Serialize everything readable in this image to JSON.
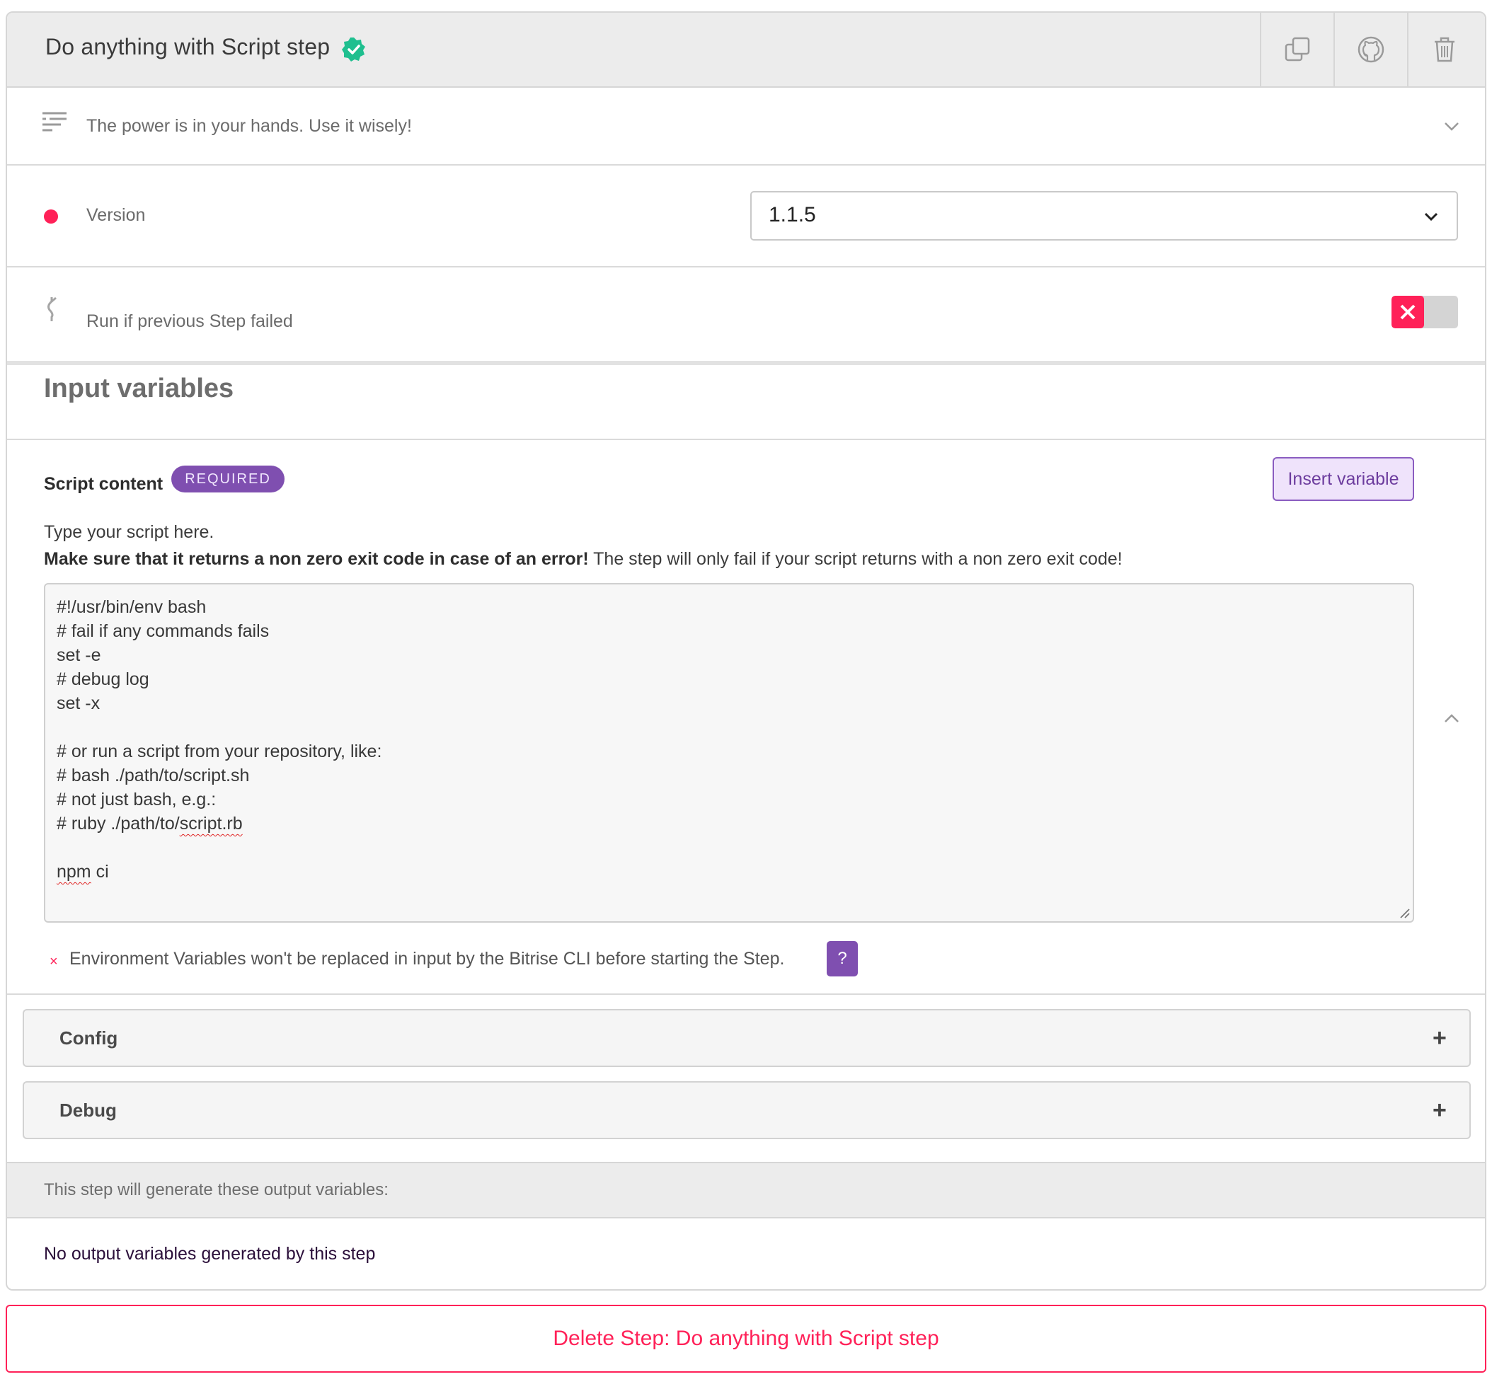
{
  "header": {
    "title": "Do anything with Script step",
    "actions": {
      "duplicate_icon": "duplicate-icon",
      "github_icon": "github-icon",
      "trash_icon": "trash-icon"
    }
  },
  "summary": {
    "text": "The power is in your hands. Use it wisely!"
  },
  "version": {
    "label": "Version",
    "selected": "1.1.5",
    "status_color": "#ff2158"
  },
  "run_if_failed": {
    "label": "Run if previous Step failed",
    "enabled": false
  },
  "inputs": {
    "section_title": "Input variables",
    "script": {
      "label": "Script content",
      "badge": "REQUIRED",
      "insert_button": "Insert variable",
      "description_line1": "Type your script here.",
      "description_bold": "Make sure that it returns a non zero exit code in case of an error!",
      "description_rest": " The step will only fail if your script returns with a non zero exit code!",
      "lines": [
        "#!/usr/bin/env bash",
        "# fail if any commands fails",
        "set -e",
        "# debug log",
        "set -x",
        "",
        "# or run a script from your repository, like:",
        "# bash ./path/to/script.sh",
        "# not just bash, e.g.:",
        "# ruby ./path/to/",
        "",
        "ci"
      ],
      "line10_spell": "script.rb",
      "line12_spell": "npm"
    },
    "env_note": "Environment Variables won't be replaced in input by the Bitrise CLI before starting the Step.",
    "env_mark": "×",
    "help": "?"
  },
  "accordions": {
    "config": "Config",
    "debug": "Debug",
    "expand_symbol": "+"
  },
  "outputs": {
    "header": "This step will generate these output variables:",
    "empty": "No output variables generated by this step"
  },
  "delete_button": "Delete Step: Do anything with Script step",
  "colors": {
    "accent_red": "#ff2158",
    "accent_purple": "#7f4fb0",
    "verified_green": "#1fbf8f"
  }
}
